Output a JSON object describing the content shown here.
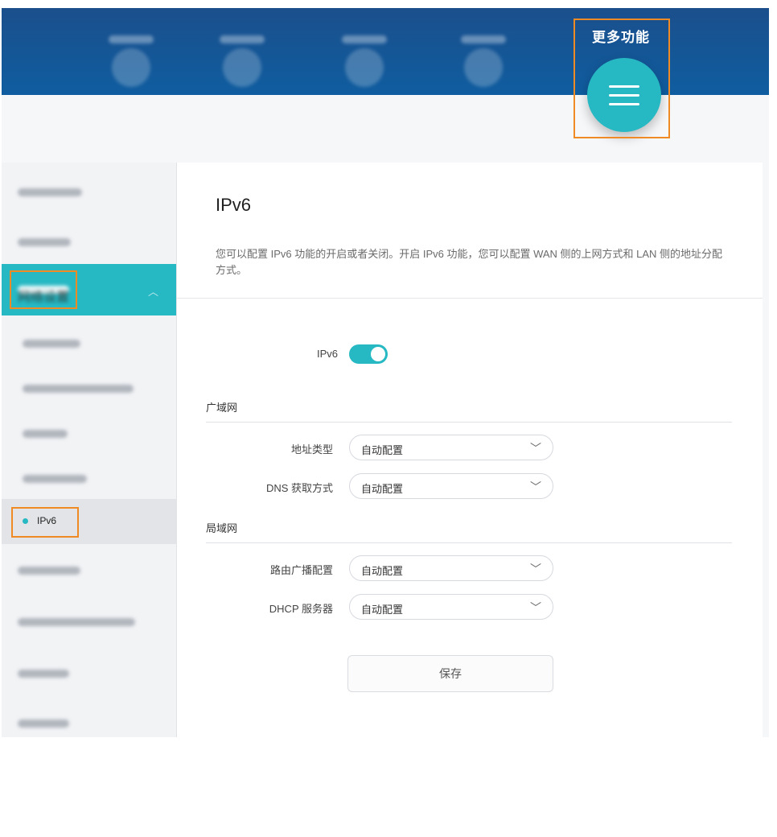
{
  "header": {
    "more_functions_label": "更多功能",
    "menu_icon": "hamburger-menu-icon",
    "nav_icons": [
      "nav-icon-1",
      "nav-icon-2",
      "nav-icon-3",
      "nav-icon-4"
    ]
  },
  "sidebar": {
    "active_group_label": "网络设置",
    "selected_item_label": "IPv6"
  },
  "main": {
    "title": "IPv6",
    "description": "您可以配置 IPv6 功能的开启或者关闭。开启 IPv6 功能，您可以配置 WAN 侧的上网方式和 LAN 侧的地址分配方式。",
    "ipv6_toggle_label": "IPv6",
    "ipv6_enabled": true,
    "wan_section_title": "广域网",
    "address_type_label": "地址类型",
    "address_type_value": "自动配置",
    "dns_method_label": "DNS 获取方式",
    "dns_method_value": "自动配置",
    "lan_section_title": "局域网",
    "ra_config_label": "路由广播配置",
    "ra_config_value": "自动配置",
    "dhcp_server_label": "DHCP 服务器",
    "dhcp_server_value": "自动配置",
    "save_label": "保存"
  },
  "colors": {
    "header_blue": "#0f5da0",
    "accent_teal": "#26b8c3",
    "highlight_orange": "#f08a24"
  }
}
